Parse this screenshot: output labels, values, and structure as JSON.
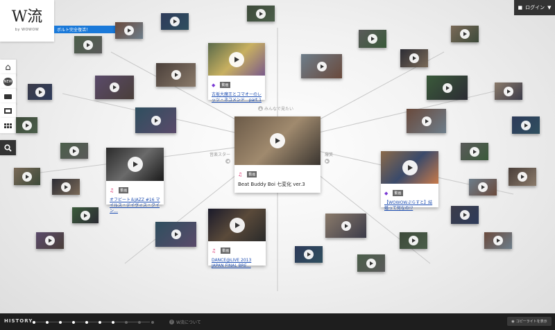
{
  "app": {
    "logo_main": "W流",
    "logo_sub": "by WOWOW"
  },
  "header": {
    "login_label": "ログイン",
    "login_caret": "▼"
  },
  "banner": {
    "text": "ボルト完全復活！"
  },
  "sidebar": {
    "items": [
      {
        "name": "home",
        "icon": "home-icon",
        "glyph": "⌂"
      },
      {
        "name": "new",
        "icon": "new-icon",
        "glyph": "NEW"
      },
      {
        "name": "genre",
        "icon": "briefcase-icon",
        "glyph": "▬"
      },
      {
        "name": "folder",
        "icon": "folder-icon",
        "glyph": "▭"
      },
      {
        "name": "grid",
        "icon": "grid-icon",
        "glyph": "▦"
      },
      {
        "name": "search",
        "icon": "search-icon",
        "glyph": "⌕"
      }
    ]
  },
  "directions": {
    "up": "みんなで見たい",
    "left": "音楽スター",
    "right": "爆笑"
  },
  "cards": {
    "center": {
      "tag": "動画",
      "icon": "♫",
      "title": "Beat Buddy Boi 七変化 ver.3"
    },
    "top": {
      "tag": "動画",
      "icon": "◆",
      "title": "古坂大魔王とコマオーのレッツ・ネコメンド　part.1"
    },
    "left": {
      "tag": "動画",
      "icon": "♫",
      "title": "オフビート＆JAZZ #16 マイルス・デイヴィス・クイン…"
    },
    "bottom": {
      "tag": "動画",
      "icon": "♫",
      "title": "DANCE@LIVE 2013 JAPAN FINAL BRE…"
    },
    "right": {
      "tag": "動画",
      "icon": "◆",
      "title": "【WOWOWぷらすと】結婚って何なの!?"
    }
  },
  "thumb_colors": [
    "#3d4a3a",
    "#6a4a3c",
    "#2e3b5a",
    "#4b5e4a",
    "#5a5a5a",
    "#7a6a58",
    "#2c2c34",
    "#4a3f3a",
    "#6d7d8a",
    "#3a5a3a",
    "#8a7a6a",
    "#3c3c4a",
    "#5a4a6a",
    "#2f4f5f"
  ],
  "footer": {
    "history_label": "HISTORY",
    "about_label": "W流について",
    "about_icon": "?",
    "copyright_label": "コピーライトを表示"
  }
}
